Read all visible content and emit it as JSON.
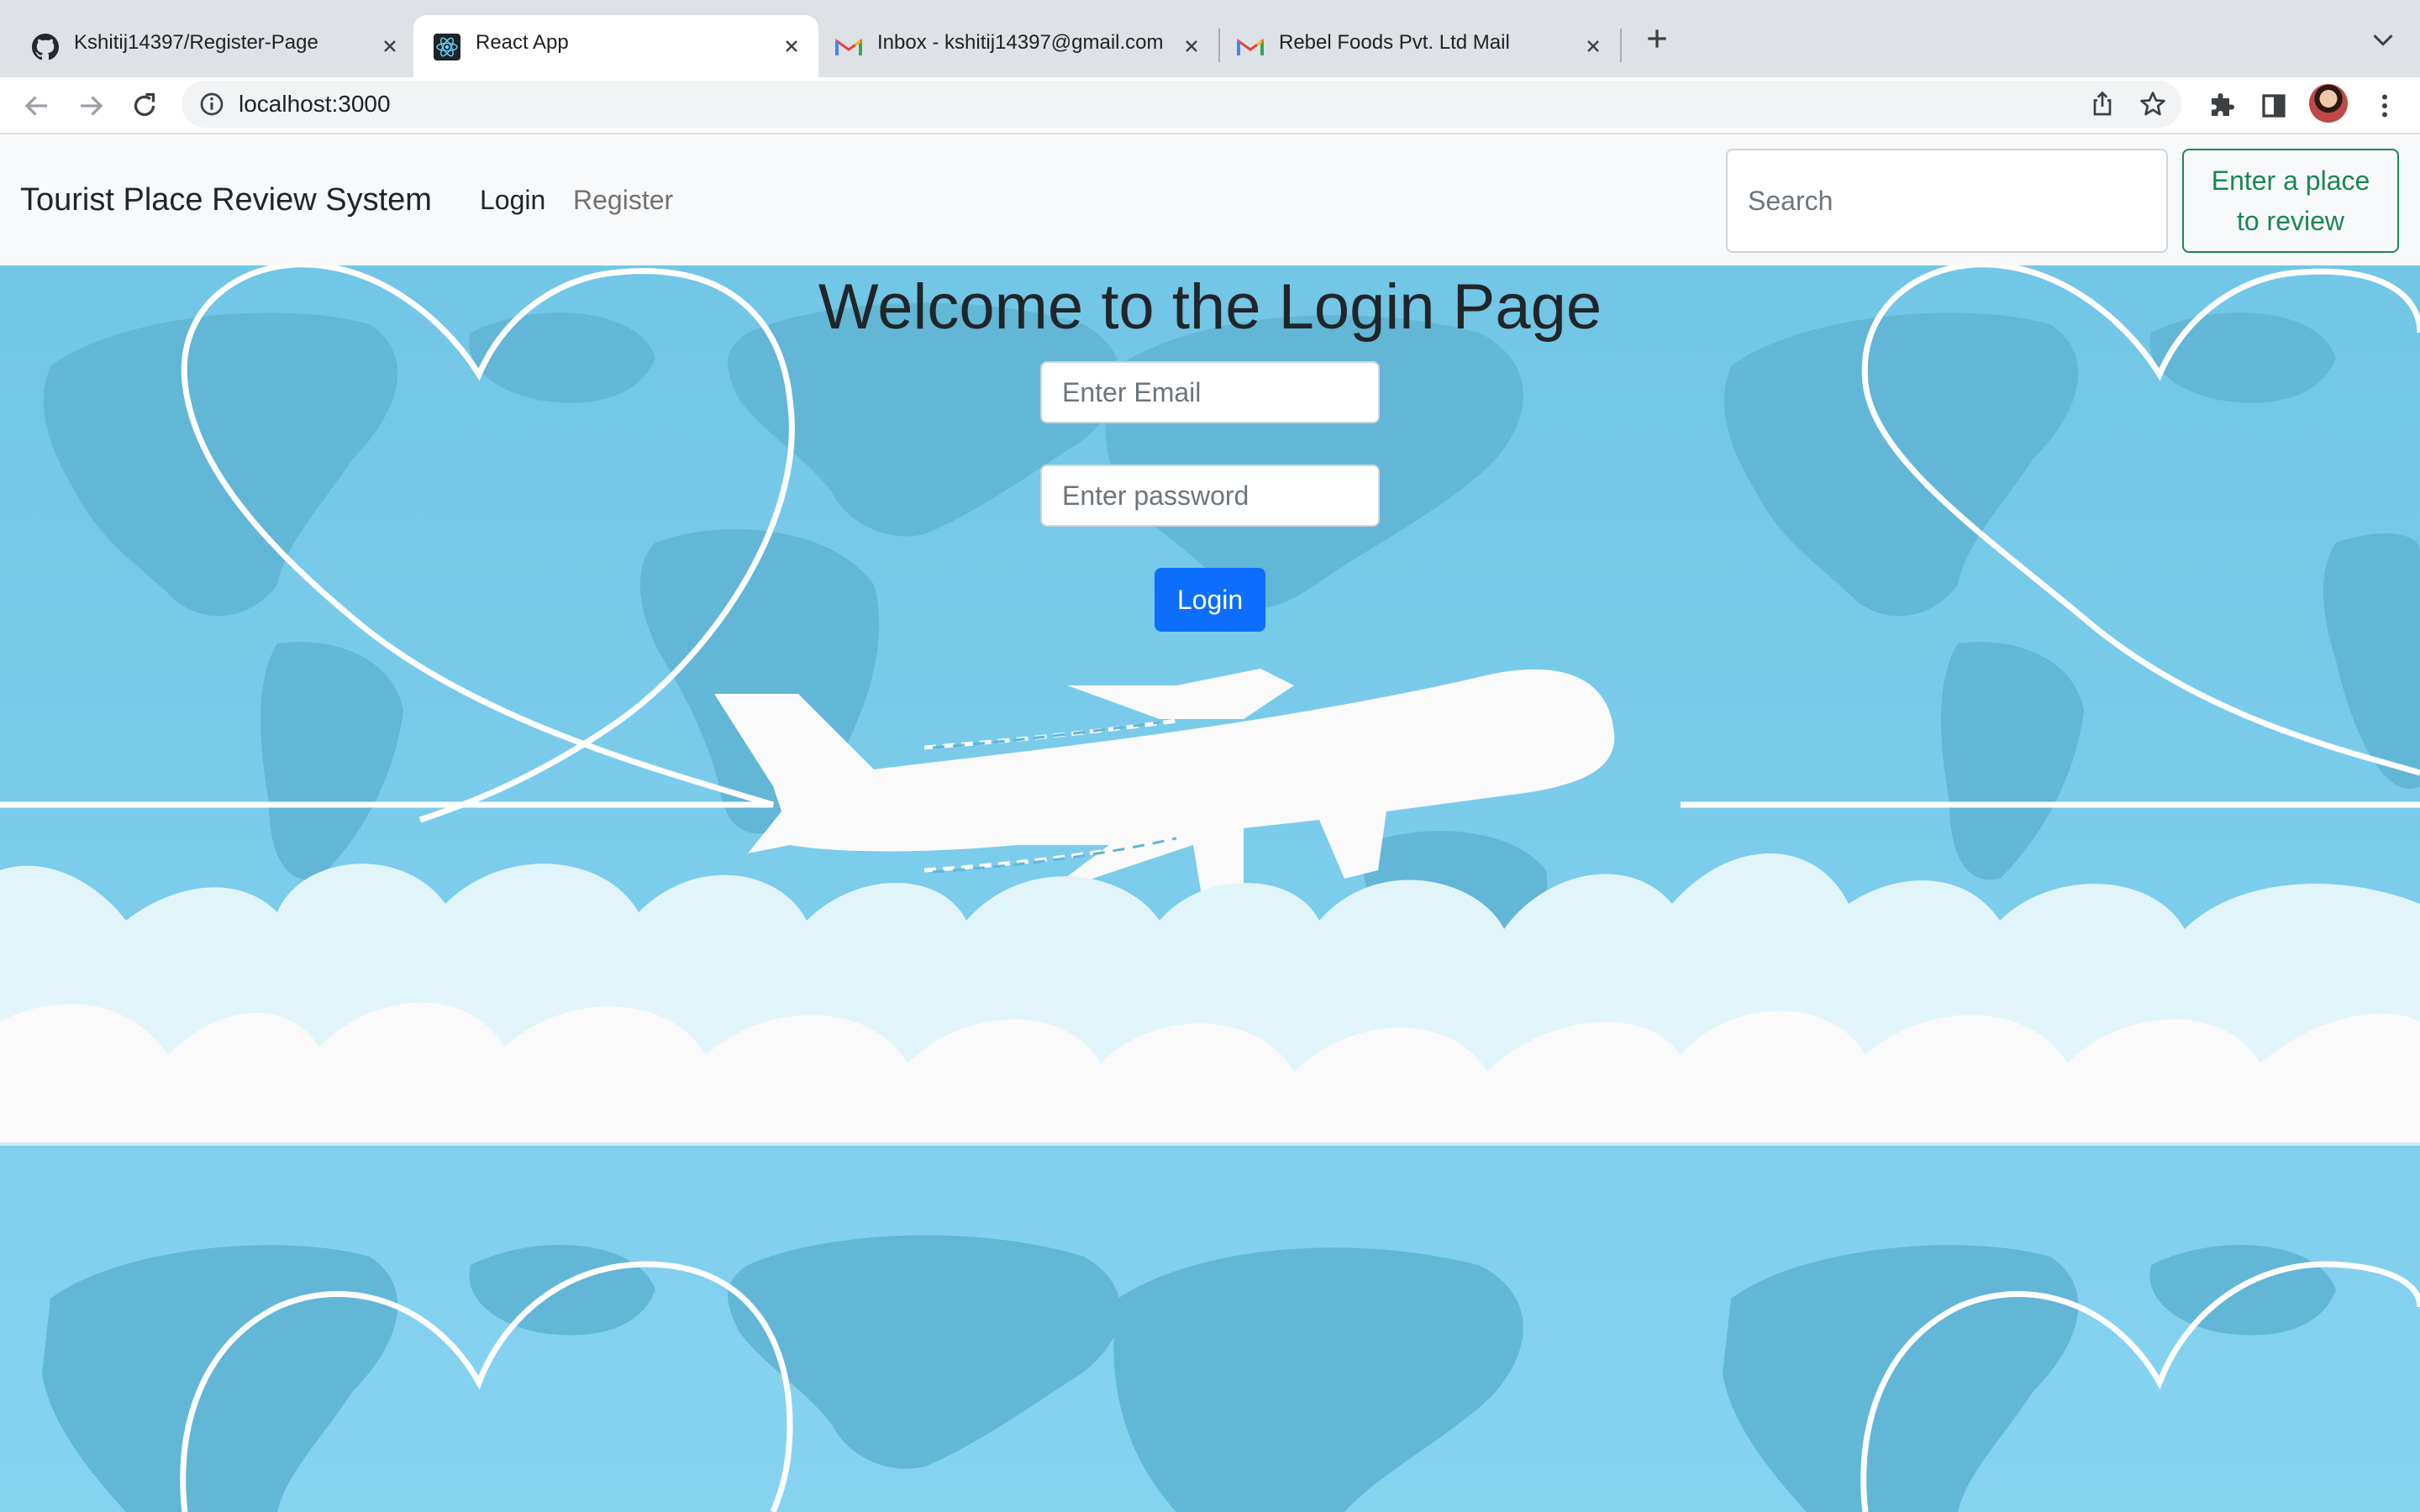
{
  "browser": {
    "tabs": [
      {
        "title": "Kshitij14397/Register-Page",
        "icon": "github-icon",
        "active": false
      },
      {
        "title": "React App",
        "icon": "react-icon",
        "active": true
      },
      {
        "title": "Inbox - kshitij14397@gmail.com",
        "icon": "gmail-icon",
        "active": false
      },
      {
        "title": "Rebel Foods Pvt. Ltd Mail",
        "icon": "gmail-icon",
        "active": false
      }
    ],
    "url": "localhost:3000"
  },
  "navbar": {
    "brand": "Tourist Place Review System",
    "links": [
      {
        "label": "Login",
        "active": true
      },
      {
        "label": "Register",
        "active": false
      }
    ],
    "search_placeholder": "Search",
    "review_button": "Enter a place to review"
  },
  "login": {
    "heading": "Welcome to the Login Page",
    "email_placeholder": "Enter Email",
    "password_placeholder": "Enter password",
    "button_label": "Login"
  },
  "colors": {
    "primary": "#0d6efd",
    "success": "#198754",
    "navbar_bg": "#f8f9fa",
    "sky": "#7ecdea",
    "map_land": "#62b6d6",
    "cloud": "#e1f4fa"
  }
}
